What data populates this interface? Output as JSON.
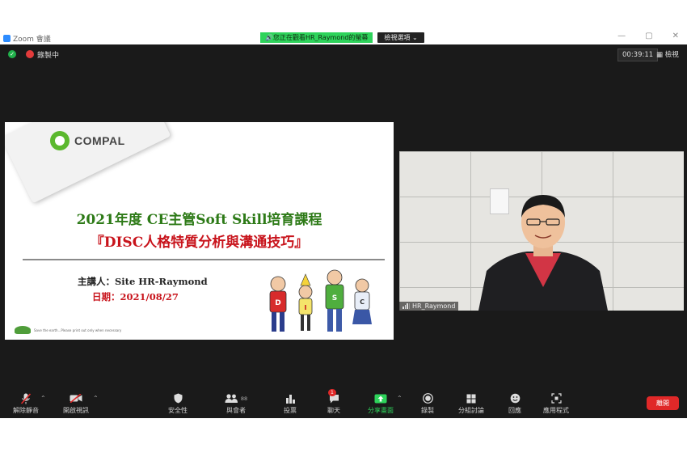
{
  "window": {
    "app_title": "Zoom 會議",
    "share_banner": "您正在觀看HR_Raymond的螢幕",
    "view_options": "檢視選項 ⌄",
    "controls": [
      "—",
      "▢",
      "✕"
    ]
  },
  "topbar": {
    "recording_label": "錄製中",
    "timer": "00:39:11",
    "view_label": "檢視"
  },
  "slide": {
    "logo_text": "COMPAL",
    "title_line1": "2021年度 CE主管Soft Skill培育課程",
    "title_line2": "『DISC人格特質分析與溝通技巧』",
    "speaker": "主講人：Site HR-Raymond",
    "date": "日期：2021/08/27",
    "footer": "Save the earth...Please print out only when necessary",
    "disc_letters": [
      "D",
      "I",
      "S",
      "C"
    ]
  },
  "video": {
    "participant_name": "HR_Raymond"
  },
  "toolbar": {
    "unmute": "解除靜音",
    "start_video": "開啟視訊",
    "security": "安全性",
    "participants": "與會者",
    "participant_count": "88",
    "polls": "投票",
    "chat": "聊天",
    "chat_badge": "1",
    "share_screen": "分享畫面",
    "record": "錄製",
    "breakout": "分組討論",
    "reactions": "回應",
    "apps": "應用程式",
    "leave": "離開"
  },
  "colors": {
    "meeting_bg": "#1a1a1a",
    "share_green": "#2ed35b",
    "leave_red": "#e02828",
    "slide_green": "#2d7a17",
    "slide_red": "#c8131b"
  }
}
